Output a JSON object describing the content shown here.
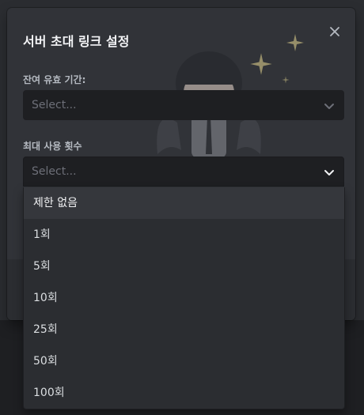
{
  "modal": {
    "title": "서버 초대 링크 설정",
    "expire_label": "잔여 유효 기간:",
    "expire_placeholder": "Select...",
    "max_uses_label": "최대 사용 횟수",
    "max_uses_placeholder": "Select..."
  },
  "dropdown": {
    "options": [
      "제한 없음",
      "1회",
      "5회",
      "10회",
      "25회",
      "50회",
      "100회"
    ],
    "highlighted_index": 0
  },
  "icons": {
    "close": "close-icon",
    "chevron": "chevron-down-icon",
    "sparkle": "sparkle-icon"
  },
  "colors": {
    "modal_bg": "#313338",
    "input_bg": "#1e1f22",
    "dropdown_bg": "#2b2d31",
    "highlight_bg": "#35373c",
    "title": "#f2f3f5",
    "label": "#b5bac1",
    "placeholder": "#6d6f78",
    "sparkle": "#e5d38a"
  }
}
